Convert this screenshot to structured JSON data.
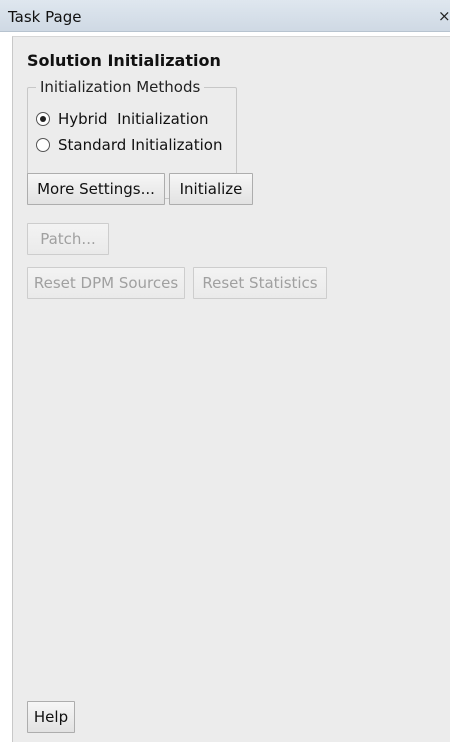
{
  "window": {
    "title": "Task Page",
    "close_symbol": "×"
  },
  "panel": {
    "heading": "Solution Initialization",
    "methods_group": {
      "legend": "Initialization Methods",
      "options": [
        {
          "label": "Hybrid  Initialization",
          "selected": true
        },
        {
          "label": "Standard Initialization",
          "selected": false
        }
      ]
    },
    "buttons": {
      "more_settings": "More Settings...",
      "initialize": "Initialize",
      "patch": "Patch...",
      "reset_dpm_sources": "Reset DPM Sources",
      "reset_statistics": "Reset Statistics",
      "help": "Help"
    }
  },
  "icons": {
    "close": "close-icon"
  }
}
